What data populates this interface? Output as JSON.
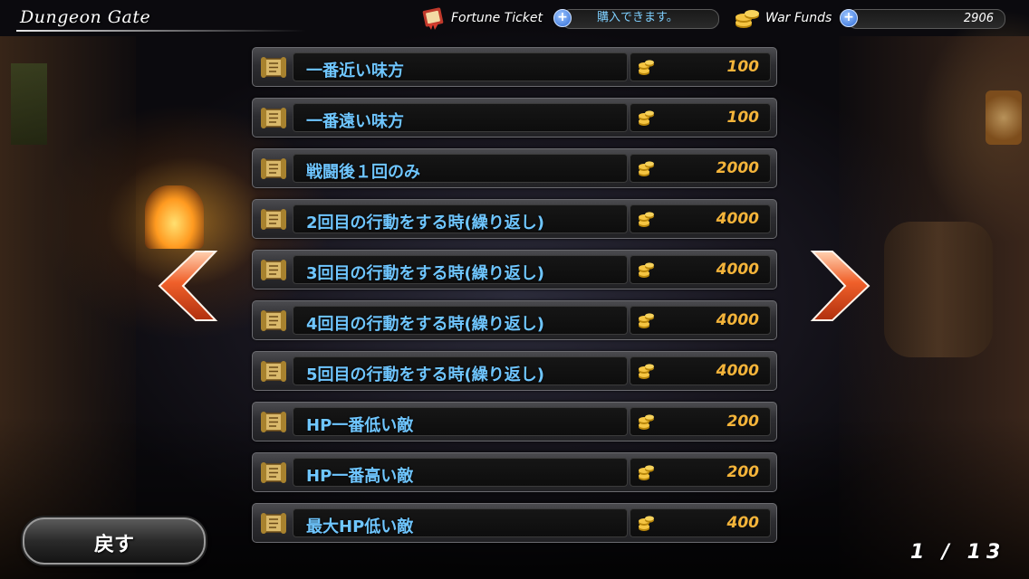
{
  "header": {
    "title": "Dungeon Gate",
    "fortune_ticket_label": "Fortune Ticket",
    "fortune_ticket_value": "購入できます。",
    "war_funds_label": "War Funds",
    "war_funds_value": "2906",
    "plus_symbol": "+"
  },
  "items": [
    {
      "label": "一番近い味方",
      "price": "100"
    },
    {
      "label": "一番遠い味方",
      "price": "100"
    },
    {
      "label": "戦闘後１回のみ",
      "price": "2000"
    },
    {
      "label": "2回目の行動をする時(繰り返し)",
      "price": "4000"
    },
    {
      "label": "3回目の行動をする時(繰り返し)",
      "price": "4000"
    },
    {
      "label": "4回目の行動をする時(繰り返し)",
      "price": "4000"
    },
    {
      "label": "5回目の行動をする時(繰り返し)",
      "price": "4000"
    },
    {
      "label": "HP一番低い敵",
      "price": "200"
    },
    {
      "label": "HP一番高い敵",
      "price": "200"
    },
    {
      "label": "最大HP低い敵",
      "price": "400"
    }
  ],
  "back_button_label": "戻す",
  "pager": "1 / 13",
  "icons": {
    "item": "scroll-icon",
    "price": "coin-stack-icon",
    "ticket": "ticket-icon",
    "funds": "coin-stack-icon",
    "prev": "chevron-left-icon",
    "next": "chevron-right-icon"
  },
  "colors": {
    "label_text": "#6fc6ff",
    "price_text": "#f4b43a",
    "arrow": "#f0602a"
  }
}
